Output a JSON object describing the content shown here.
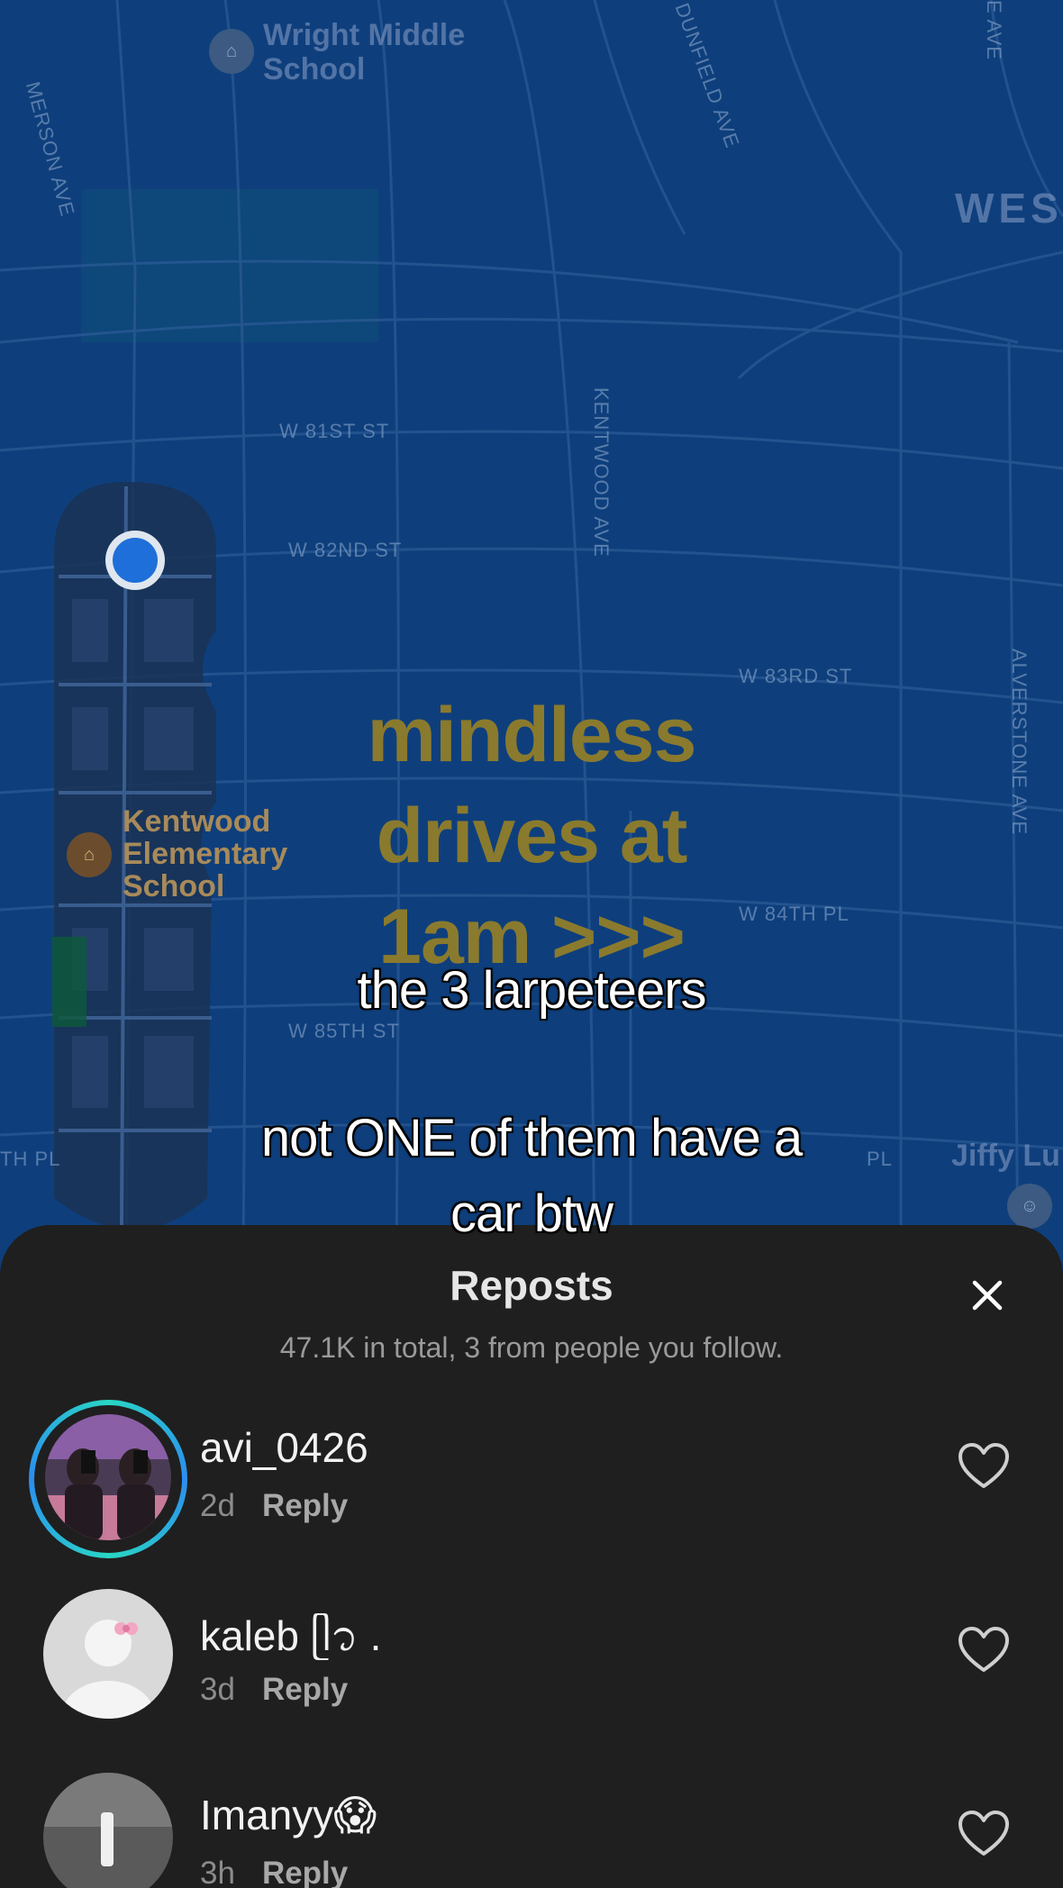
{
  "map": {
    "labels": {
      "wright_school": "Wright Middle\nSchool",
      "emerson": "MERSON AVE",
      "dunfield": "DUNFIELD AVE",
      "top_right_ave": "E AVE",
      "west": "WEST",
      "w81": "W 81ST ST",
      "w82": "W 82ND ST",
      "kentwood": "KENTWOOD AVE",
      "w83": "W 83RD ST",
      "alverstone": "ALVERSTONE AVE",
      "kentwood_school": "Kentwood\nElementary\nSchool",
      "w84": "W 84TH PL",
      "w85": "W 85TH ST",
      "th_pl_left": "TH PL",
      "pl_right": "PL",
      "jiffy": "Jiffy Lu"
    },
    "overlay_text": "mindless drives at 1am >>>",
    "accent_route_color": "#1a3355",
    "location_dot_color": "#1e6fd9"
  },
  "captions": {
    "line1": "the 3 larpeteers",
    "line2": "not ONE of them have a",
    "line3": "car btw"
  },
  "sheet": {
    "title": "Reposts",
    "subtitle": "47.1K in total, 3 from people you follow.",
    "close_icon": "close-icon",
    "reposters": [
      {
        "username": "avi_0426",
        "age": "2d",
        "reply": "Reply",
        "has_story_ring": true
      },
      {
        "username": "kaleb ᥫ᭡ .",
        "age": "3d",
        "reply": "Reply",
        "has_story_ring": false
      },
      {
        "username": "Imanyy😱",
        "age": "3h",
        "reply": "Reply",
        "has_story_ring": false
      }
    ]
  }
}
